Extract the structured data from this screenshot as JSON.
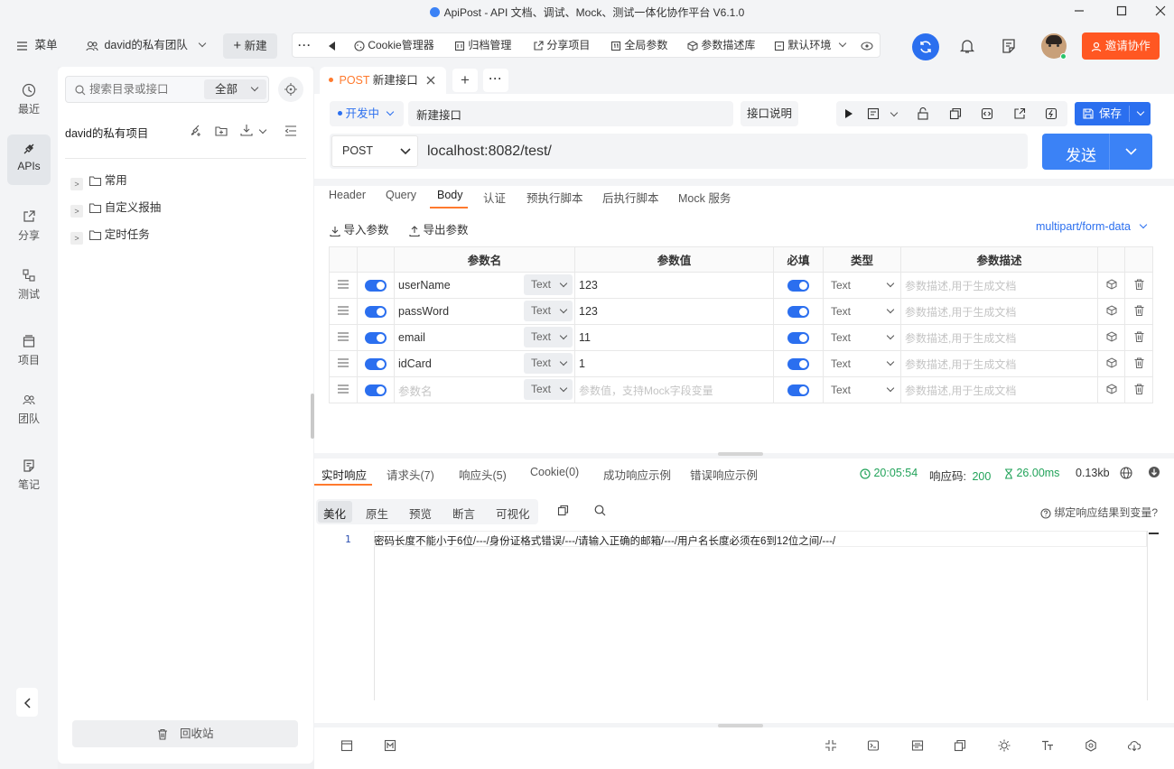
{
  "window": {
    "title": "ApiPost - API 文档、调试、Mock、测试一体化协作平台 V6.1.0"
  },
  "topbar": {
    "menu_label": "菜单",
    "team_label": "david的私有团队",
    "new_label": "新建",
    "tools": [
      "Cookie管理器",
      "归档管理",
      "分享项目",
      "全局参数",
      "参数描述库",
      "默认环境"
    ],
    "invite_label": "邀请协作"
  },
  "nav": [
    {
      "label": "最近",
      "icon": "clock-icon"
    },
    {
      "label": "APIs",
      "icon": "api-icon"
    },
    {
      "label": "分享",
      "icon": "share-icon"
    },
    {
      "label": "测试",
      "icon": "test-icon"
    },
    {
      "label": "项目",
      "icon": "project-icon"
    },
    {
      "label": "团队",
      "icon": "team-icon"
    },
    {
      "label": "笔记",
      "icon": "note-icon"
    }
  ],
  "sidebar": {
    "search_placeholder": "搜索目录或接口",
    "filter_label": "全部",
    "project_name": "david的私有项目",
    "folders": [
      "常用",
      "自定义报抽",
      "定时任务"
    ],
    "recycle_label": "回收站"
  },
  "request": {
    "tab_method": "POST",
    "tab_name": "新建接口",
    "status": "开发中",
    "name": "新建接口",
    "doc_label": "接口说明",
    "save_label": "保存",
    "method": "POST",
    "url": "localhost:8082/test/",
    "send_label": "发送"
  },
  "body_tabs": [
    "Header",
    "Query",
    "Body",
    "认证",
    "预执行脚本",
    "后执行脚本",
    "Mock 服务"
  ],
  "body": {
    "import_label": "导入参数",
    "export_label": "导出参数",
    "content_type": "multipart/form-data",
    "columns": [
      "参数名",
      "参数值",
      "必填",
      "类型",
      "参数描述"
    ],
    "rows": [
      {
        "name": "userName",
        "ftype": "Text",
        "value": "123",
        "type": "Text"
      },
      {
        "name": "passWord",
        "ftype": "Text",
        "value": "123",
        "type": "Text"
      },
      {
        "name": "email",
        "ftype": "Text",
        "value": "11",
        "type": "Text"
      },
      {
        "name": "idCard",
        "ftype": "Text",
        "value": "1",
        "type": "Text"
      },
      {
        "name": "",
        "ftype": "Text",
        "value": "",
        "type": "Text"
      }
    ],
    "name_placeholder": "参数名",
    "value_placeholder": "参数值，支持Mock字段变量",
    "desc_placeholder": "参数描述,用于生成文档"
  },
  "response": {
    "tabs": [
      "实时响应",
      "请求头(7)",
      "响应头(5)",
      "Cookie(0)",
      "成功响应示例",
      "错误响应示例"
    ],
    "time": "20:05:54",
    "code_label": "响应码:",
    "code": "200",
    "duration": "26.00ms",
    "size": "0.13kb",
    "views": [
      "美化",
      "原生",
      "预览",
      "断言",
      "可视化"
    ],
    "bind_label": "绑定响应结果到变量?",
    "line_no": "1",
    "content": "密码长度不能小于6位/---/身份证格式错误/---/请输入正确的邮箱/---/用户名长度必须在6到12位之间/---/"
  },
  "colors": {
    "accent": "#2b6fef",
    "send": "#3b82f6",
    "invite": "#ff5722",
    "success": "#22a35a",
    "post": "#ff7a2e"
  }
}
